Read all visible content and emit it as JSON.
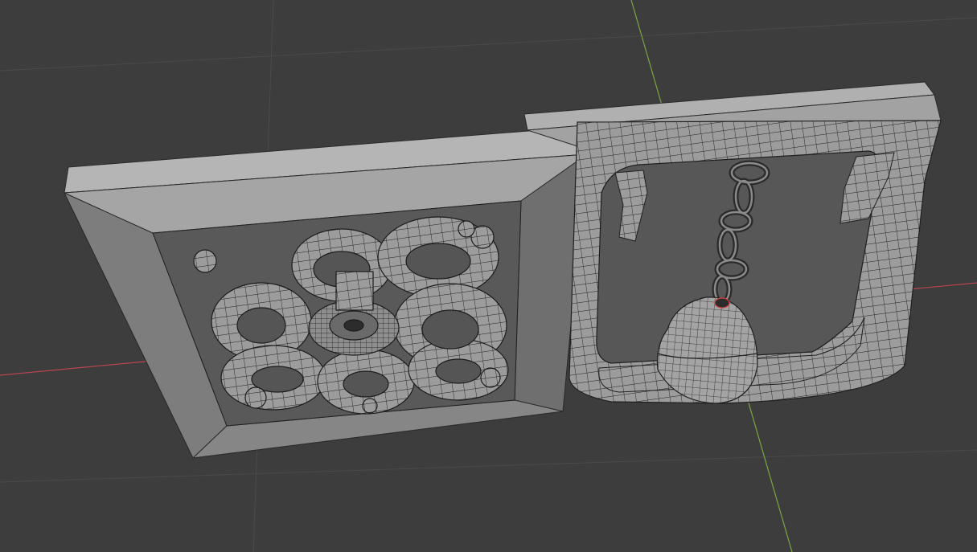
{
  "app": {
    "name": ""
  },
  "viewport": {
    "mode": "wireframe-overlay",
    "background_color": "#3d3d3d",
    "grid_color": "#4a4a4a",
    "x_axis_color": "#b8454f",
    "y_axis_color": "#7da542",
    "object_color": "#a8a8a8",
    "wire_color": "#1e1e1e"
  },
  "objects": [
    {
      "label": "",
      "kind": "lattice-panel",
      "icon": "floral-lattice"
    },
    {
      "label": "",
      "kind": "bell-panel",
      "icon": "hanging-bell"
    }
  ]
}
